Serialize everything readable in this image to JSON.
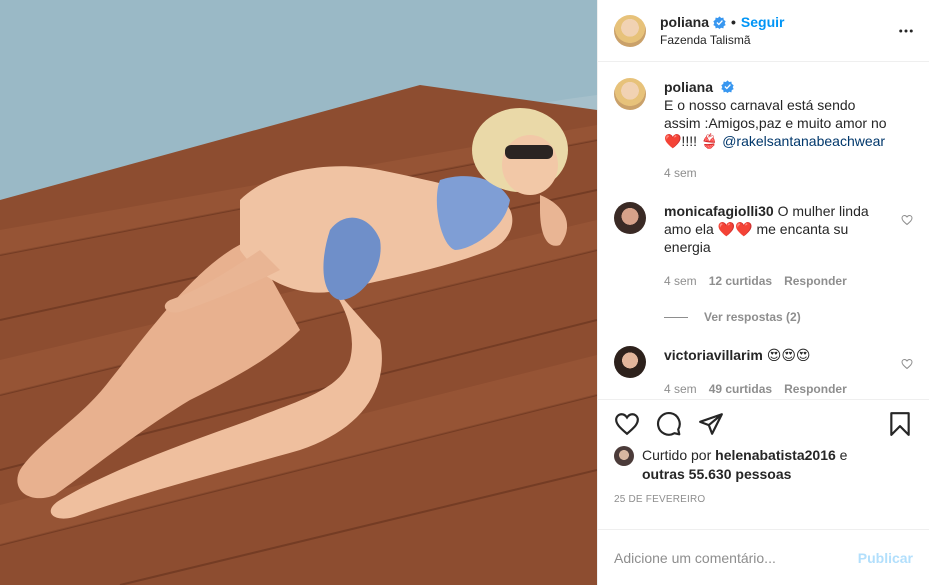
{
  "photo": {
    "alt_subject": "woman-on-wooden-deck"
  },
  "header": {
    "username": "poliana",
    "separator": "•",
    "follow_label": "Seguir",
    "location": "Fazenda Talismã"
  },
  "caption": {
    "username": "poliana",
    "text": "E o nosso carnaval está sendo assim :Amigos,paz e muito amor no ❤️!!!! 👙",
    "mention": "@rakelsantanabeachwear",
    "time": "4 sem"
  },
  "comments": [
    {
      "username": "monicafagiolli30",
      "text": "O mulher linda amo ela ❤️❤️ me encanta su energia",
      "time": "4 sem",
      "likes": "12 curtidas",
      "reply_label": "Responder",
      "view_replies": "Ver respostas (2)"
    },
    {
      "username": "victoriavillarim",
      "text": "😍😍😍",
      "time": "4 sem",
      "likes": "49 curtidas",
      "reply_label": "Responder"
    }
  ],
  "likes": {
    "prefix": "Curtido por",
    "user": "helenabatista2016",
    "conj": "e",
    "others": "outras 55.630 pessoas"
  },
  "date": "25 DE FEVEREIRO",
  "add_comment": {
    "placeholder": "Adicione um comentário...",
    "publish_label": "Publicar"
  },
  "colors": {
    "link": "#0095f6",
    "publish_disabled": "#b2dffc",
    "muted": "#8e8e8e",
    "text": "#262626"
  }
}
